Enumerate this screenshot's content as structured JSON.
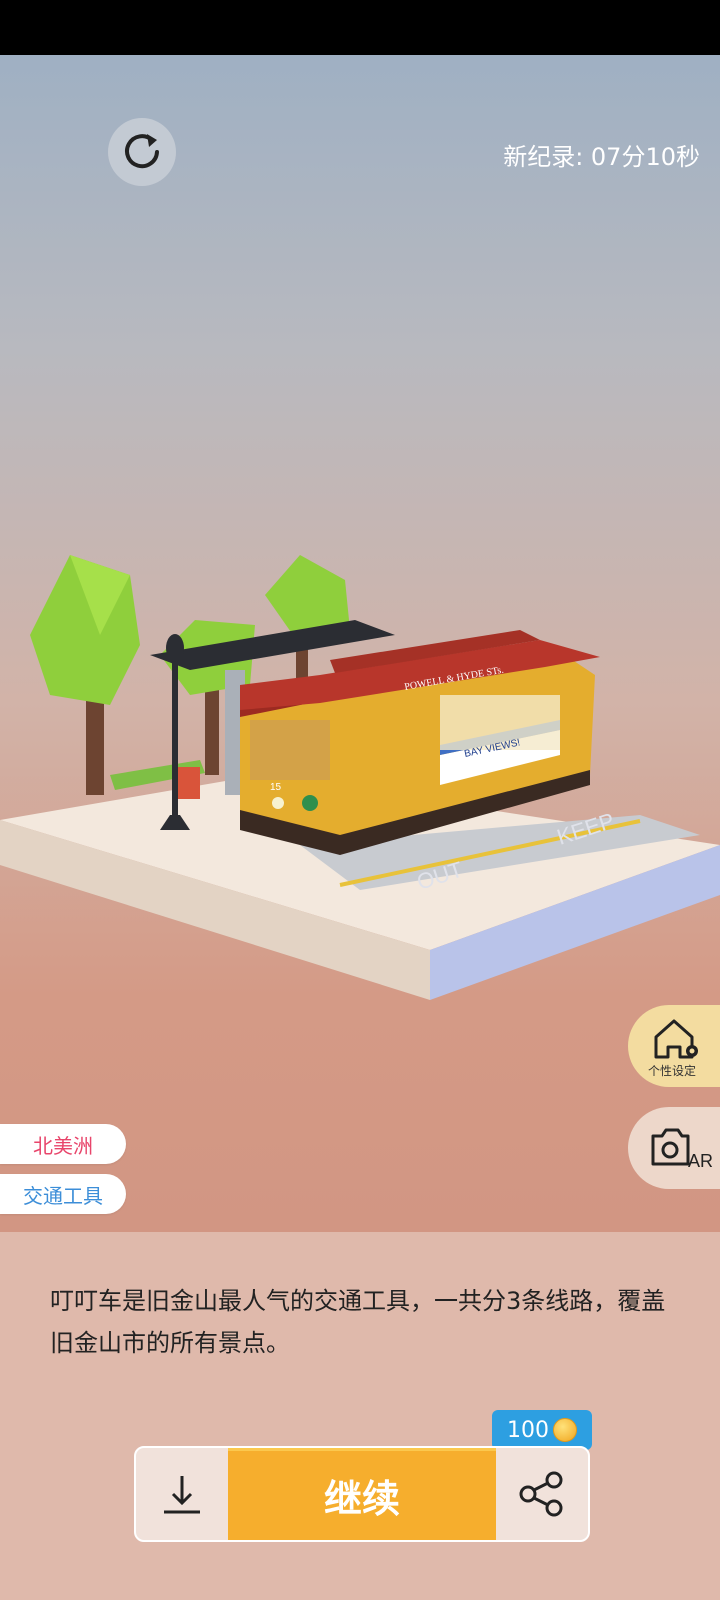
{
  "header": {
    "record_text": "新纪录: 07分10秒"
  },
  "side_buttons": {
    "customize_label": "个性设定",
    "ar_label": "AR"
  },
  "tags": {
    "region": "北美洲",
    "category": "交通工具"
  },
  "description": "叮叮车是旧金山最人气的交通工具，一共分3条线路，覆盖旧金山市的所有景点。",
  "actions": {
    "continue_label": "继续",
    "share_reward": "100"
  },
  "tram_signs": {
    "route_sign": "POWELL & HYDE STs.",
    "car_number": "15",
    "billboard": "BAY VIEWS!",
    "road_text_1": "OUT",
    "road_text_2": "KEEP"
  },
  "colors": {
    "continue": "#f6ae2d",
    "badge": "#2d9fe1",
    "region_tag": "#e8456b",
    "category_tag": "#3c8ed8"
  },
  "icons": [
    "restart-icon",
    "customize-home-icon",
    "ar-camera-icon",
    "download-icon",
    "share-icon",
    "coin-icon"
  ]
}
